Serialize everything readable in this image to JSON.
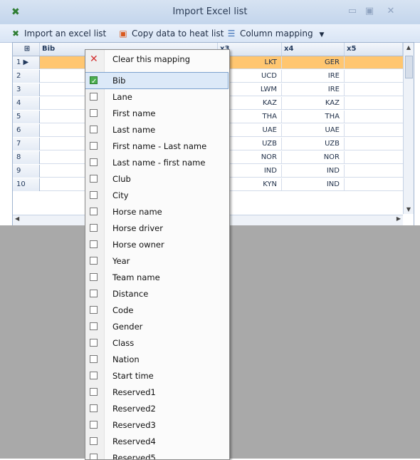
{
  "window": {
    "title": "Import Excel list",
    "app_icon": "excel-icon"
  },
  "toolbar": {
    "import_label": "Import an excel list",
    "copy_label": "Copy data to heat list",
    "mapping_label": "Column mapping"
  },
  "grid": {
    "headers": [
      "Bib",
      "x3",
      "x4",
      "x5"
    ],
    "rows": [
      {
        "n": "1",
        "x3": "LKT",
        "x4": "GER"
      },
      {
        "n": "2",
        "x3": "UCD",
        "x4": "IRE"
      },
      {
        "n": "3",
        "x3": "LWM",
        "x4": "IRE"
      },
      {
        "n": "4",
        "x3": "KAZ",
        "x4": "KAZ"
      },
      {
        "n": "5",
        "x3": "THA",
        "x4": "THA"
      },
      {
        "n": "6",
        "x3": "UAE",
        "x4": "UAE"
      },
      {
        "n": "7",
        "x3": "UZB",
        "x4": "UZB"
      },
      {
        "n": "8",
        "x3": "NOR",
        "x4": "NOR"
      },
      {
        "n": "9",
        "x3": "IND",
        "x4": "IND"
      },
      {
        "n": "10",
        "x3": "KYN",
        "x4": "IND"
      }
    ]
  },
  "menu": {
    "clear_label": "Clear this mapping",
    "items": [
      "Bib",
      "Lane",
      "First name",
      "Last name",
      "First name - Last name",
      "Last name - first name",
      "Club",
      "City",
      "Horse name",
      "Horse driver",
      "Horse owner",
      "Year",
      "Team name",
      "Distance",
      "Code",
      "Gender",
      "Class",
      "Nation",
      "Start time",
      "Reserved1",
      "Reserved2",
      "Reserved3",
      "Reserved4",
      "Reserved5"
    ],
    "checked": "Bib"
  }
}
